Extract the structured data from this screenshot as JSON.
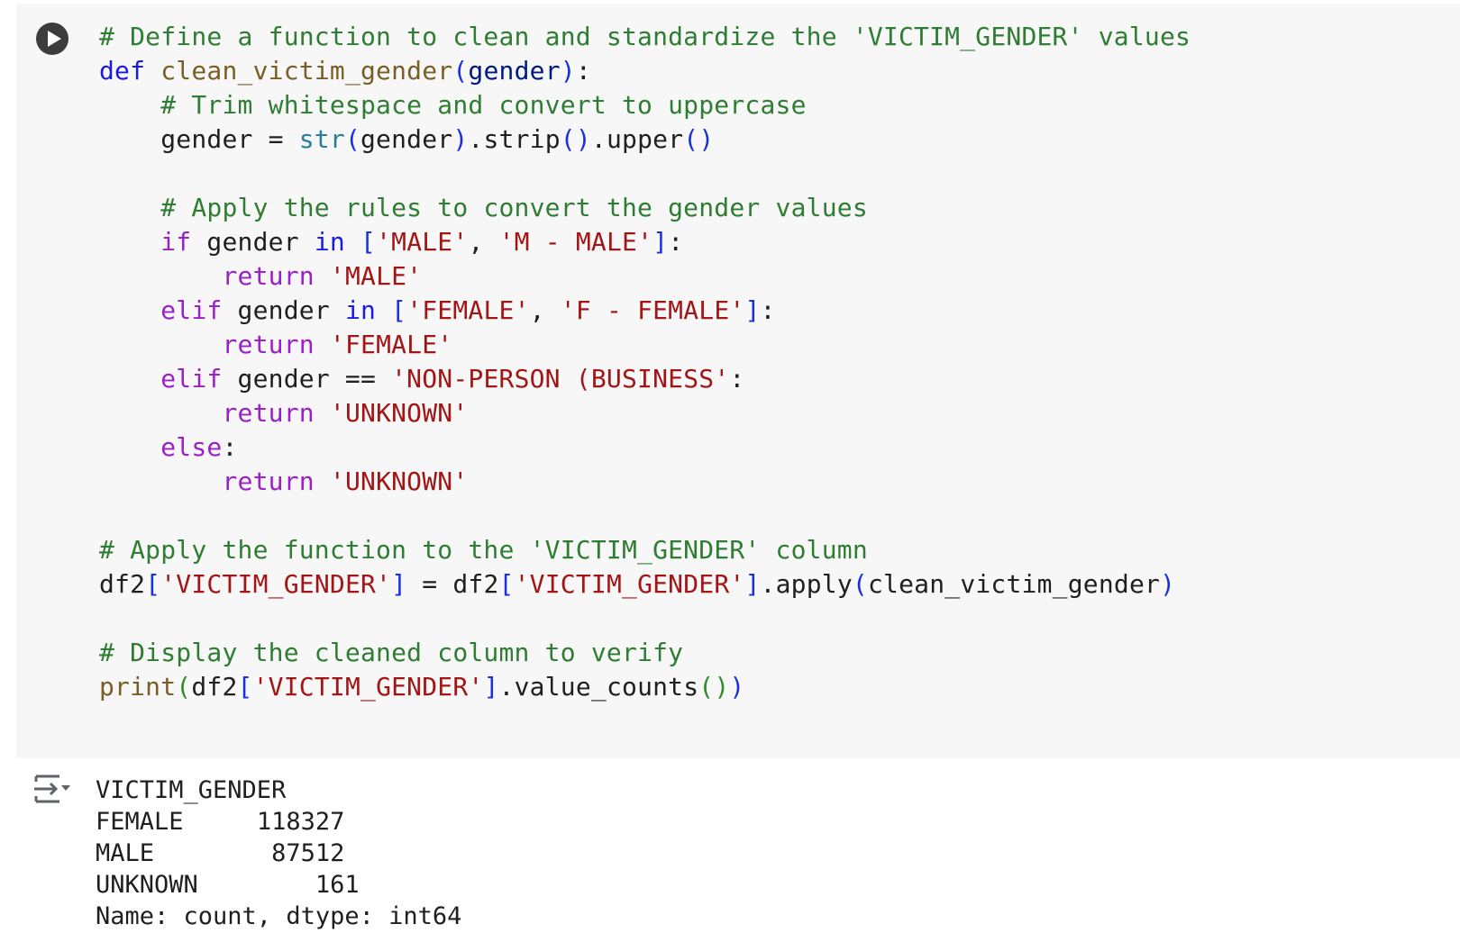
{
  "cell": {
    "run_button": "run-cell",
    "code_lines": [
      "# Define a function to clean and standardize the 'VICTIM_GENDER' values",
      "def clean_victim_gender(gender):",
      "    # Trim whitespace and convert to uppercase",
      "    gender = str(gender).strip().upper()",
      "",
      "    # Apply the rules to convert the gender values",
      "    if gender in ['MALE', 'M - MALE']:",
      "        return 'MALE'",
      "    elif gender in ['FEMALE', 'F - FEMALE']:",
      "        return 'FEMALE'",
      "    elif gender == 'NON-PERSON (BUSINESS':",
      "        return 'UNKNOWN'",
      "    else:",
      "        return 'UNKNOWN'",
      "",
      "# Apply the function to the 'VICTIM_GENDER' column",
      "df2['VICTIM_GENDER'] = df2['VICTIM_GENDER'].apply(clean_victim_gender)",
      "",
      "# Display the cleaned column to verify",
      "print(df2['VICTIM_GENDER'].value_counts())"
    ]
  },
  "output": {
    "icon": "output-toggle-icon",
    "header": "VICTIM_GENDER",
    "rows": [
      {
        "label": "FEMALE",
        "value": "118327"
      },
      {
        "label": "MALE",
        "value": "87512"
      },
      {
        "label": "UNKNOWN",
        "value": "161"
      }
    ],
    "footer": "Name: count, dtype: int64"
  },
  "colors": {
    "comment": "#2e7d32",
    "keyword": "#1a1ae6",
    "control_keyword": "#9b20c5",
    "function_name": "#795e26",
    "string": "#a31515",
    "cell_background": "#f7f7f7"
  }
}
